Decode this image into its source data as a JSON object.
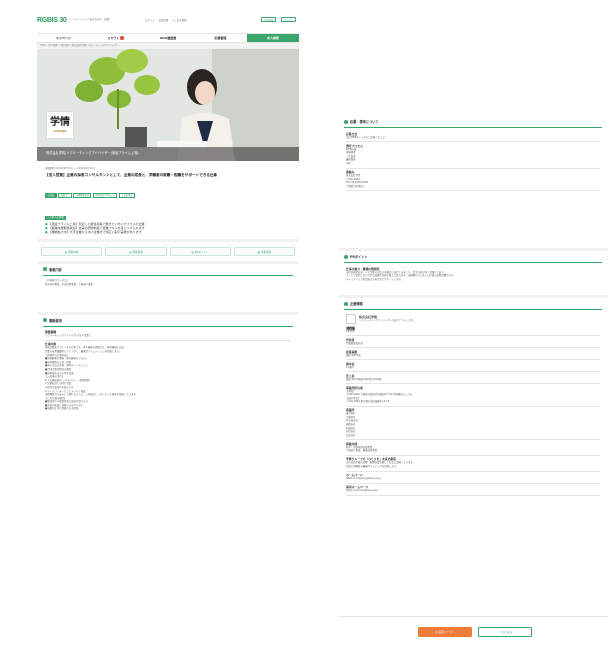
{
  "header": {
    "logo": "RGBIS 30",
    "logo_tag": "ドライバージョブ 株式会社社・就職サイト",
    "nav": [
      "ログイン",
      "会員登録",
      "よくある質問"
    ],
    "btn1": "会員登録",
    "btn2": "ログイン"
  },
  "menu": {
    "items": [
      "マイページ",
      "スカウト",
      "Web履歴書",
      "応募管理",
      "求人検索"
    ],
    "active_index": 4
  },
  "breadcrumb": "TOP > 求人検索 > 東京都 > 株式会社学情リクルーティングアドバイザー",
  "hero": {
    "company": "株式会社学情[リクルーティングアドバイザー(東証プライム上場)",
    "logo_text": "学情",
    "logo_sub": "GAKUJO"
  },
  "job": {
    "meta": "掲載期間 2024年9月11日 〜 2024年9月24日",
    "title": "【法人営業】企業の採用コンサルタントとして、企業の成長と、求職者の就職・転職をサポートできる仕事",
    "tags": [
      "正社員",
      "転勤なし",
      "未経験者歓迎",
      "年間休日120日以上",
      "土日祝休み"
    ],
    "feature_label": "この求人の特徴",
    "bullets": [
      "【東証プライム上場】安定した経営基盤で働きたい方にオススメの企業",
      "【職種未経験者歓迎】充実の研修制度で営業スキルを身につけられます",
      "【業績拡大中】大手企業から中小企業まで幅広い取引実績があります"
    ]
  },
  "buttons": [
    "募集内容",
    "募集要項",
    "PRポイント",
    "企業情報"
  ],
  "business": {
    "title": "事業内容",
    "lines": [
      "【人材紹介サービス】",
      "新卒採用事業、中途採用事業、人材紹介事業"
    ]
  },
  "recruit": {
    "title": "募集要項",
    "position_label": "募集職種",
    "position": "リクルーティングアドバイザー(法人営業)",
    "work_label": "仕事内容",
    "work_lines": [
      "採用活動をサポートする仕事です。求人媒体の提案から、採用戦略の立案、",
      "企業の採用課題をヒアリングし、最適なソリューションを提案します。",
      "",
      "【具体的な仕事内容】",
      "■新規顧客の開拓・既存顧客のフォロー",
      "■採用戦略の立案・提案",
      "■求人広告の企画・制作ディレクション",
      "■合同企業説明会の運営",
      "■採用成功までの伴走支援",
      "",
      "【入社後の流れ】",
      "1.入社後研修(ビジネスマナー・商材知識)",
      "2.先輩社員との同行営業",
      "3.担当企業を持ち独り立ち",
      "4.チームリーダーとしてメンバー育成",
      "",
      "未経験者でも安心して働けるように、入社後はしっかりとした研修を用意しています。",
      "",
      "【この仕事の魅力】",
      "■経営者や人事責任者と直接対話できる",
      "■企業の成長に貢献できるやりがい",
      "■成果が正当に評価される環境"
    ]
  },
  "right": {
    "apply_title": "応募・選考について",
    "apply_items": [
      {
        "label": "応募方法",
        "lines": [
          "当社WEBサイトからご応募ください"
        ]
      },
      {
        "label": "選考プロセス",
        "lines": [
          "WEB応募",
          "書類選考",
          "一次面接",
          "最終面接",
          "内定"
        ]
      },
      {
        "label": "連絡先",
        "lines": [
          "株式会社学情",
          "〒530-0001",
          "TEL 06-6346-6500",
          "人事部 採用担当"
        ]
      }
    ],
    "pr_title": "PRポイント",
    "pr_label": "仕事の魅力・職場の雰囲気",
    "pr_lines": [
      "当社は創業以来、人と企業の出会いを創造し続けてきました。若手社員が多く活躍しており、",
      "チームで協力し合いながら成果を目指す風土があります。未経験から入社した社員も多数活躍中です。",
      "キャリアアップを目指す方を全力でサポートします。"
    ],
    "company_title": "企業情報",
    "company_name": "株式会社学情",
    "company_sub": "リクルーティングアドバイザー(東証プライム上場)",
    "company_items": [
      {
        "label": "設立",
        "lines": [
          "1976年"
        ]
      },
      {
        "label": "代表者",
        "lines": [
          "代表取締役社長"
        ]
      },
      {
        "label": "従業員数",
        "lines": [
          "連結 約500名"
        ]
      },
      {
        "label": "資本金",
        "lines": [
          "15億円"
        ]
      },
      {
        "label": "売上高",
        "lines": [
          "連結 約100億円(2023年10月期)"
        ]
      },
      {
        "label": "事業所所在地",
        "lines": [
          "【本社】",
          "〒530-0001 大阪府大阪市北区梅田2-5-10 学情梅田コンパス",
          "【東京本社】",
          "〒104-0061 東京都中央区銀座4-12-15"
        ]
      },
      {
        "label": "事業所",
        "lines": [
          "東京本社",
          "大阪本社",
          "名古屋支社",
          "福岡支社",
          "札幌支社",
          "仙台支社",
          "広島支社"
        ]
      },
      {
        "label": "事業内容",
        "lines": [
          "新卒・中途採用支援事業",
          "人材紹介事業、教育研修事業"
        ]
      },
      {
        "label": "学情グループの「ひとさま」未来の創造",
        "lines": [
          "当社は若年層の就職・転職支援を通じて社会に貢献しています。",
          "企業と求職者の最適なマッチングを実現します。"
        ]
      },
      {
        "label": "ホームページ",
        "lines": [
          "https://company.gakujo.ne.jp"
        ]
      },
      {
        "label": "採用ホームページ",
        "lines": [
          "https://recruit.gakujo.ne.jp"
        ]
      }
    ]
  },
  "footer": {
    "apply": "応募ページへ",
    "save": "気になる"
  }
}
